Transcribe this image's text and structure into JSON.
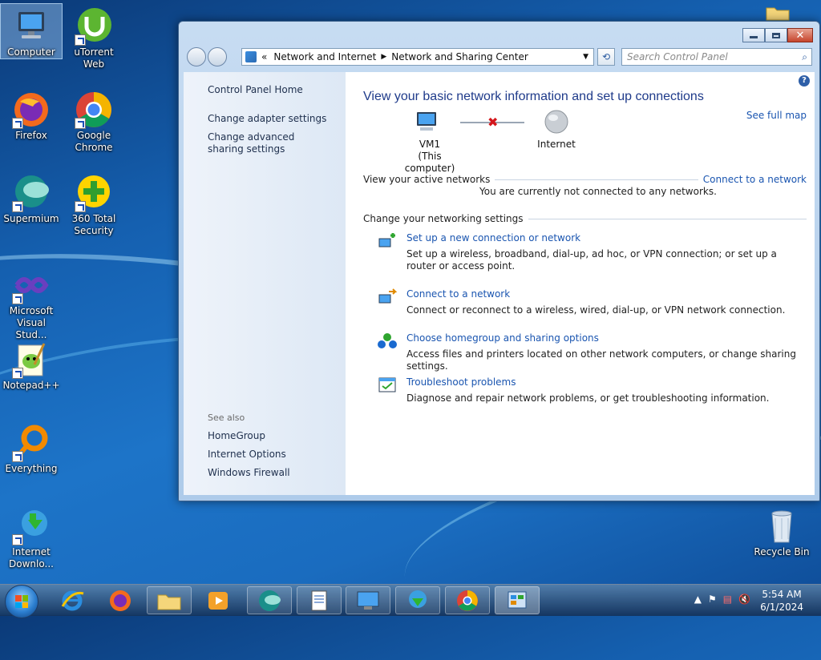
{
  "desktop": {
    "icons": [
      {
        "label": "Computer"
      },
      {
        "label": "uTorrent Web"
      },
      {
        "label": "Firefox"
      },
      {
        "label": "Google Chrome"
      },
      {
        "label": "Supermium"
      },
      {
        "label": "360 Total Security"
      },
      {
        "label": "Microsoft Visual Stud..."
      },
      {
        "label": "Notepad++"
      },
      {
        "label": "Everything"
      },
      {
        "label": "Internet Downlo..."
      },
      {
        "label": "Recycle Bin"
      }
    ]
  },
  "window": {
    "breadcrumb": [
      "«",
      "Network and Internet",
      "Network and Sharing Center"
    ],
    "search_placeholder": "Search Control Panel",
    "left_pane": {
      "home": "Control Panel Home",
      "links": [
        "Change adapter settings",
        "Change advanced sharing settings"
      ],
      "see_also_title": "See also",
      "see_also": [
        "HomeGroup",
        "Internet Options",
        "Windows Firewall"
      ]
    },
    "main": {
      "title": "View your basic network information and set up connections",
      "see_full_map": "See full map",
      "map": {
        "computer_name": "VM1",
        "computer_sub": "(This computer)",
        "internet": "Internet"
      },
      "active_networks_title": "View your active networks",
      "connect_link": "Connect to a network",
      "not_connected": "You are currently not connected to any networks.",
      "settings_title": "Change your networking settings",
      "tasks": [
        {
          "link": "Set up a new connection or network",
          "desc": "Set up a wireless, broadband, dial-up, ad hoc, or VPN connection; or set up a router or access point."
        },
        {
          "link": "Connect to a network",
          "desc": "Connect or reconnect to a wireless, wired, dial-up, or VPN network connection."
        },
        {
          "link": "Choose homegroup and sharing options",
          "desc": "Access files and printers located on other network computers, or change sharing settings."
        },
        {
          "link": "Troubleshoot problems",
          "desc": "Diagnose and repair network problems, or get troubleshooting information."
        }
      ]
    }
  },
  "taskbar": {
    "clock_time": "5:54 AM",
    "clock_date": "6/1/2024"
  },
  "colors": {
    "link": "#1a55b0",
    "title": "#1e3a8a",
    "error_x": "#d4161b"
  }
}
